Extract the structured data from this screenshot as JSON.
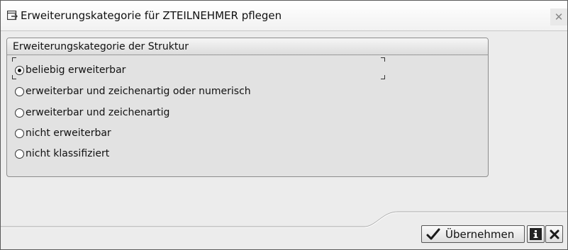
{
  "window": {
    "title": "Erweiterungskategorie für ZTEILNEHMER pflegen",
    "close_glyph": "✕"
  },
  "group": {
    "title": "Erweiterungskategorie der Struktur",
    "options": [
      {
        "label": "beliebig erweiterbar",
        "selected": true
      },
      {
        "label": "erweiterbar und zeichenartig oder numerisch",
        "selected": false
      },
      {
        "label": "erweiterbar und zeichenartig",
        "selected": false
      },
      {
        "label": "nicht erweiterbar",
        "selected": false
      },
      {
        "label": "nicht klassifiziert",
        "selected": false
      }
    ]
  },
  "footer": {
    "confirm_label": "Übernehmen",
    "confirm_icon": "check-icon",
    "info_icon": "info-icon",
    "cancel_icon": "cancel-icon"
  }
}
